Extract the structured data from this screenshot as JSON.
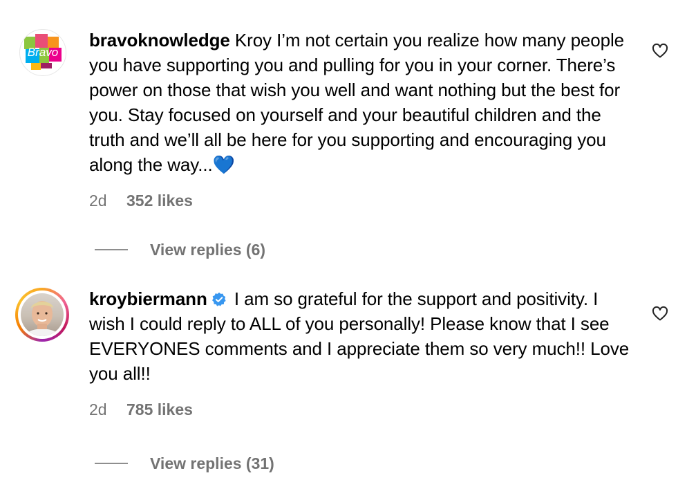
{
  "comments": [
    {
      "username": "bravoknowledge",
      "verified": false,
      "avatar_icon": "bravo-logo-icon",
      "avatar_text": "Bravo",
      "text": "Kroy I’m not certain you realize how many people you have supporting you and pulling for you in your corner. There’s power on those that wish you well and want nothing but the best for you. Stay focused on yourself and your beautiful children and the truth and we’ll all be here for you supporting and encouraging you along the way...💙",
      "time": "2d",
      "likes": "352 likes",
      "view_replies": "View replies (6)"
    },
    {
      "username": "kroybiermann",
      "verified": true,
      "avatar_icon": "profile-photo-icon",
      "text": "I am so grateful for the support and positivity. I wish I could reply to ALL of you personally! Please know that I see EVERYONES comments and I appreciate them so very much!! Love you all!!",
      "time": "2d",
      "likes": "785 likes",
      "view_replies": "View replies (31)"
    }
  ],
  "colors": {
    "secondary_text": "#737373",
    "verified_badge": "#3897f0",
    "story_ring": [
      "#f9a825",
      "#f06292",
      "#c2185b",
      "#9c27b0"
    ]
  }
}
